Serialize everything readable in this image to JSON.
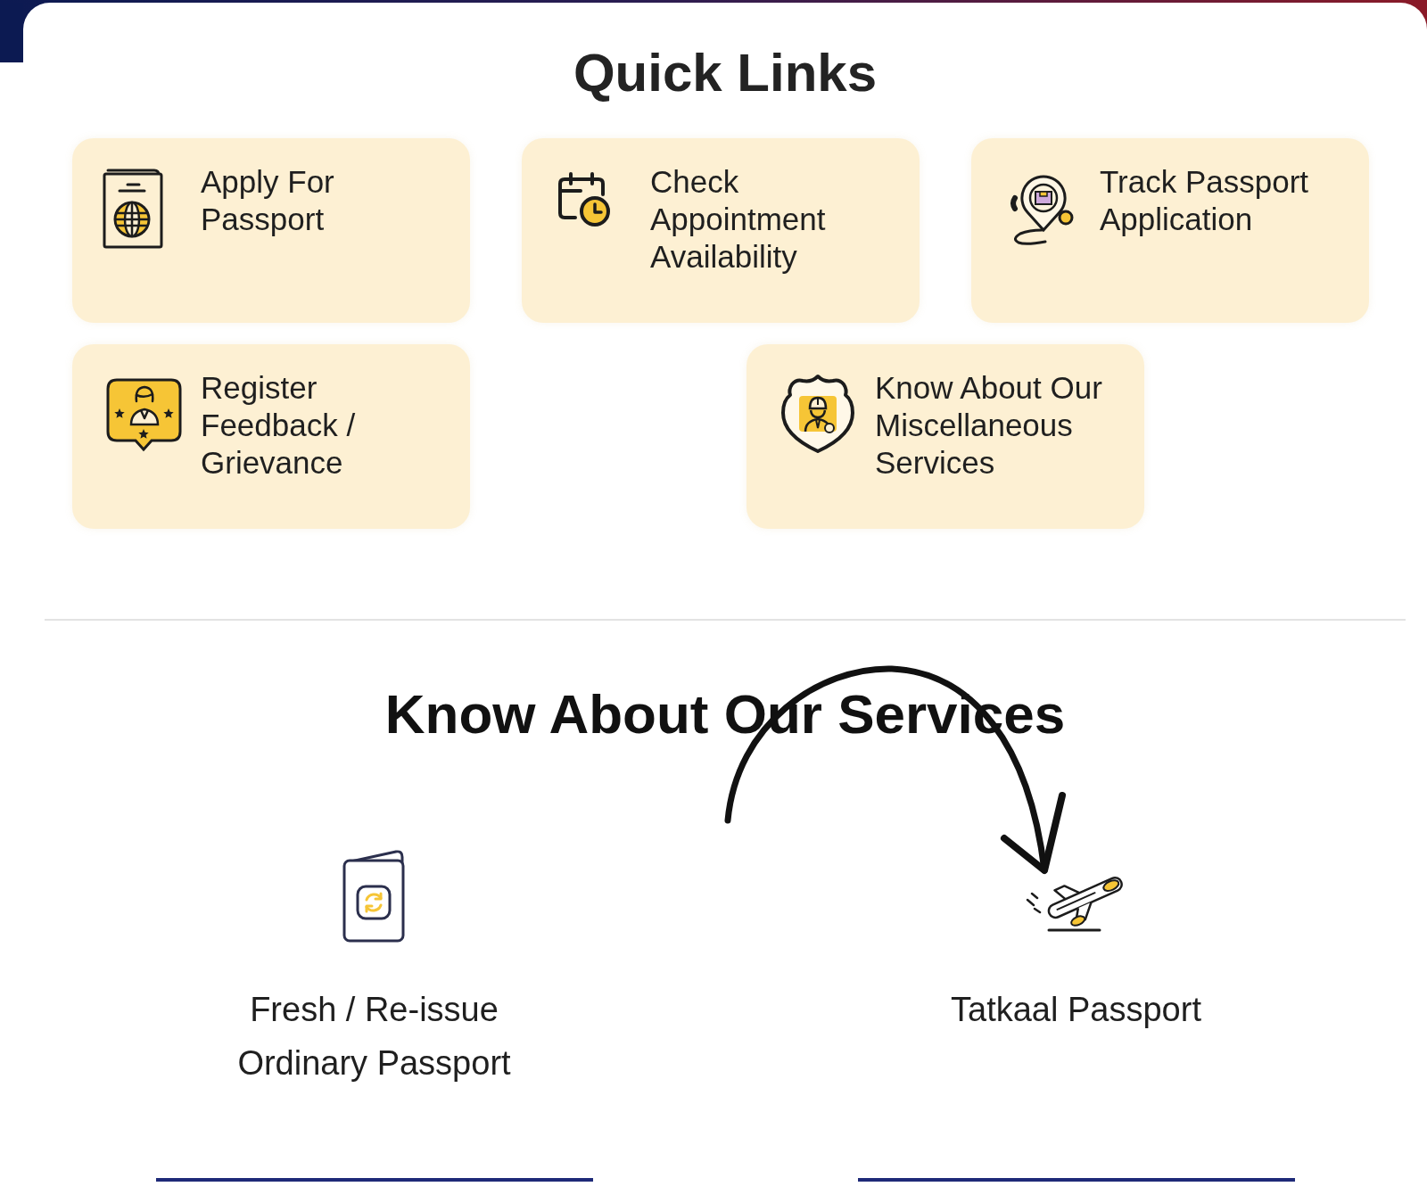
{
  "quick_links": {
    "title": "Quick Links",
    "items": [
      {
        "label": "Apply For Passport"
      },
      {
        "label": "Check Appointment Availability"
      },
      {
        "label": "Track Passport Application"
      },
      {
        "label": "Register Feedback / Grievance"
      },
      {
        "label": "Know About Our Miscellaneous Services"
      }
    ]
  },
  "services": {
    "title": "Know About Our Services",
    "items": [
      {
        "label": "Fresh / Re-issue Ordinary Passport"
      },
      {
        "label": "Tatkaal Passport"
      }
    ]
  }
}
